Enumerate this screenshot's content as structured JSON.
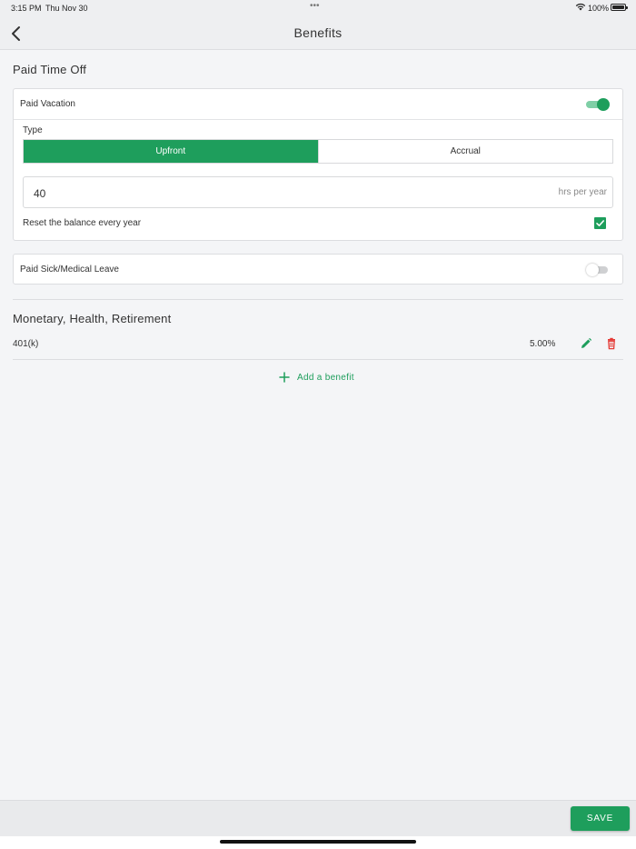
{
  "status_bar": {
    "time": "3:15 PM",
    "date": "Thu Nov 30",
    "battery": "100%"
  },
  "header": {
    "title": "Benefits",
    "back_icon": "chevron-left-icon"
  },
  "paid_time_off": {
    "title": "Paid Time Off",
    "vacation": {
      "label": "Paid Vacation",
      "enabled": true,
      "type_label": "Type",
      "type_options": [
        "Upfront",
        "Accrual"
      ],
      "selected_type": "Upfront",
      "hours_value": "40",
      "hours_unit": "hrs per year",
      "reset_label": "Reset the balance every year",
      "reset_checked": true
    },
    "sick_leave": {
      "label": "Paid Sick/Medical Leave",
      "enabled": false
    }
  },
  "monetary": {
    "title": "Monetary, Health, Retirement",
    "benefits": [
      {
        "name": "401(k)",
        "value": "5.00%",
        "edit_icon": "pencil-icon",
        "delete_icon": "trash-icon"
      }
    ],
    "add_label": "Add a benefit"
  },
  "footer": {
    "save_label": "SAVE"
  },
  "colors": {
    "accent": "#1e9e5c",
    "danger": "#e53935",
    "background": "#f4f5f7"
  }
}
